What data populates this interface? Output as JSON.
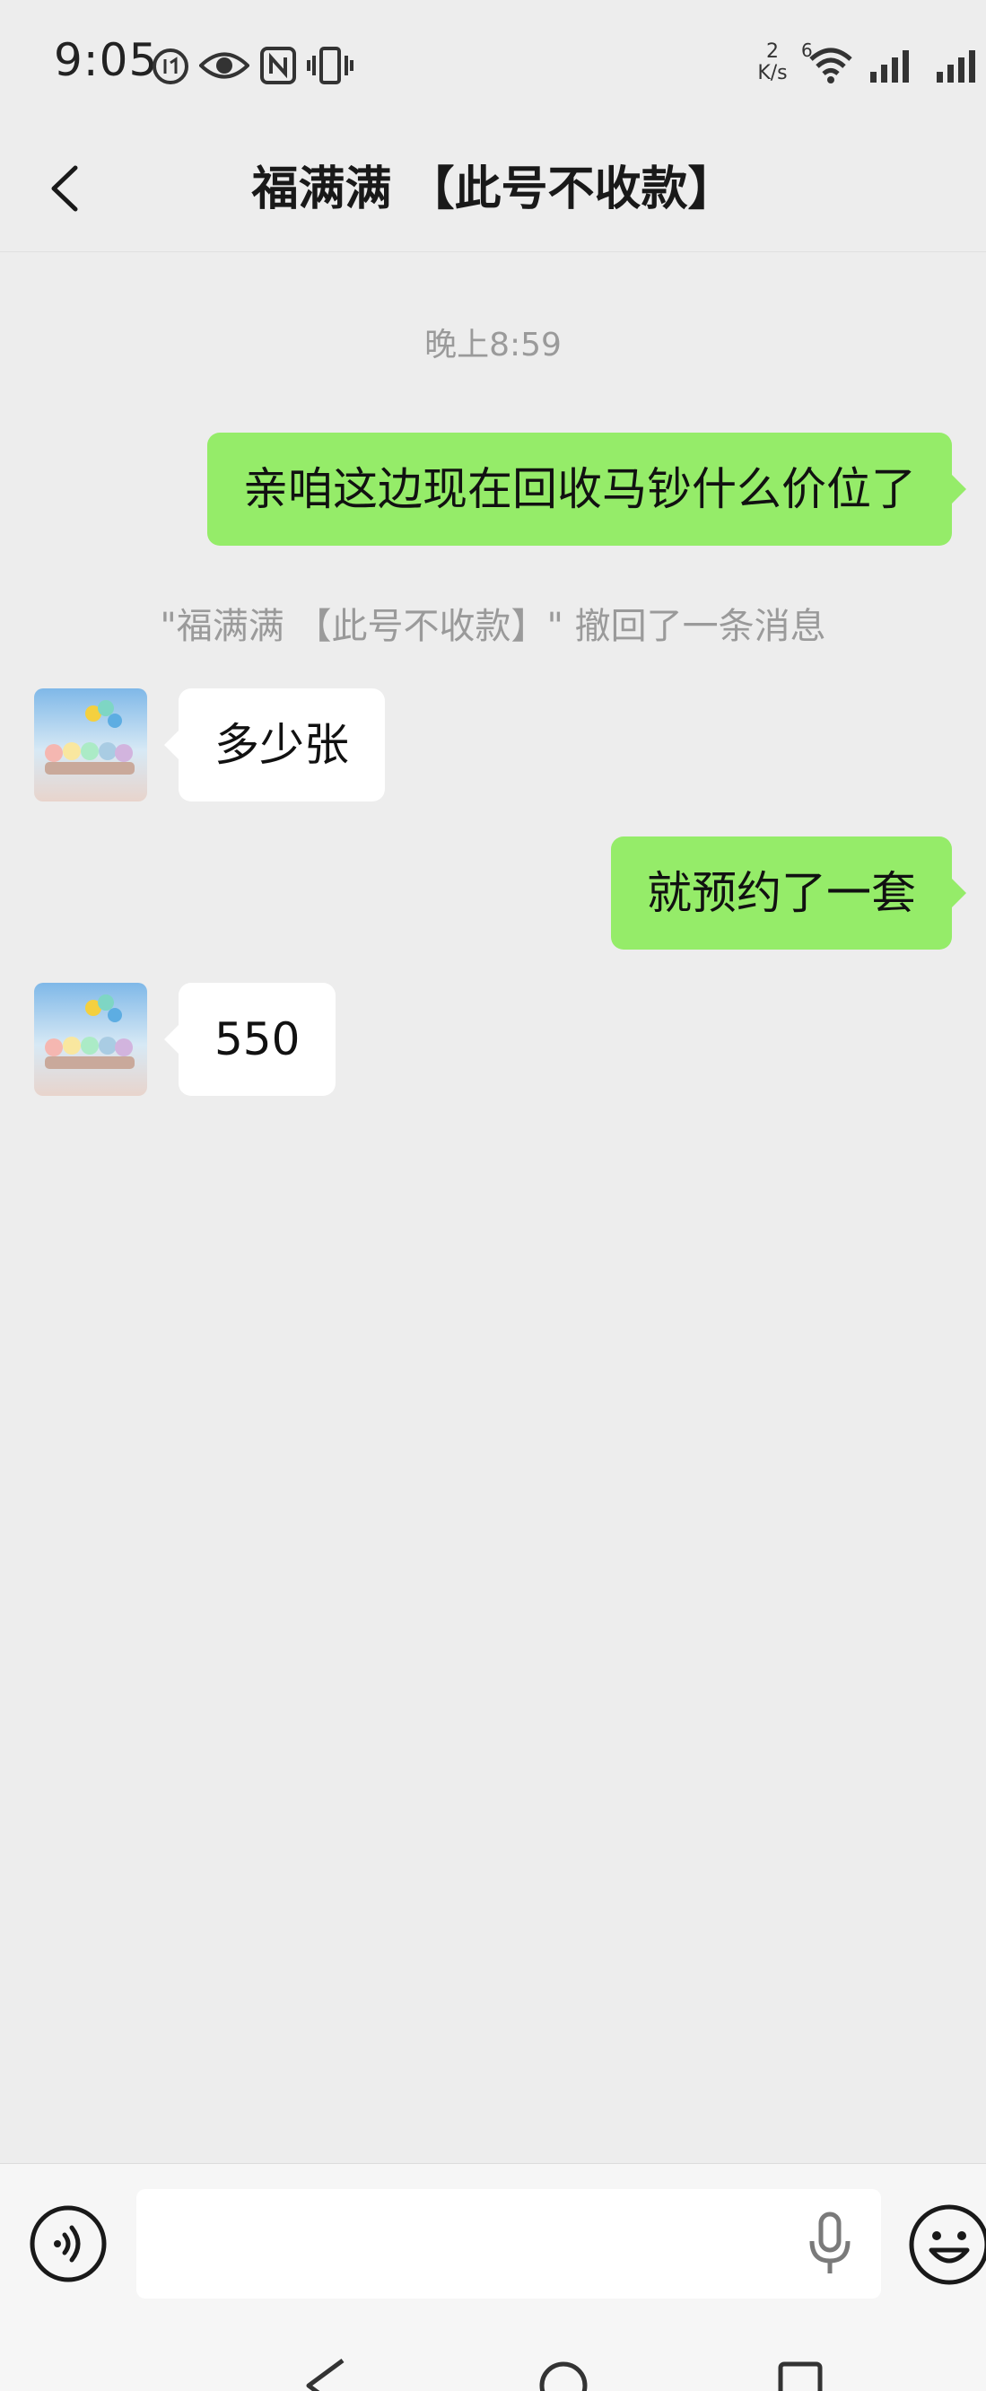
{
  "status_bar": {
    "time": "9:05",
    "net_speed_value": "2",
    "net_speed_unit": "K/s",
    "wifi_label": "6"
  },
  "header": {
    "title": "福满满 【此号不收款】"
  },
  "chat": {
    "timestamp": "晚上8:59",
    "recall_notice": "\"福满满 【此号不收款】\" 撤回了一条消息",
    "messages": [
      {
        "direction": "out",
        "text": "亲咱这边现在回收马钞什么价位了"
      },
      {
        "direction": "in",
        "text": "多少张"
      },
      {
        "direction": "out",
        "text": "就预约了一套"
      },
      {
        "direction": "in",
        "text": "550"
      }
    ]
  },
  "input_bar": {
    "value": "",
    "placeholder": ""
  },
  "icons": {
    "back": "chevron-left-icon",
    "voice": "voice-icon",
    "mic": "microphone-icon",
    "emoji": "emoji-icon",
    "nav_back": "triangle-back-icon",
    "nav_home": "circle-home-icon",
    "nav_recent": "square-recent-icon"
  },
  "colors": {
    "background": "#ededed",
    "outgoing_bubble": "#95ec69",
    "incoming_bubble": "#ffffff",
    "system_text": "#9a9a9a"
  }
}
